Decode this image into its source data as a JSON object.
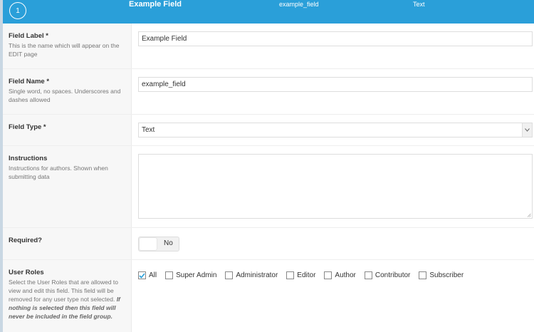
{
  "header": {
    "order": "1",
    "label": "Example Field",
    "name": "example_field",
    "type": "Text"
  },
  "field_label": {
    "title": "Field Label *",
    "desc": "This is the name which will appear on the EDIT page",
    "value": "Example Field"
  },
  "field_name": {
    "title": "Field Name *",
    "desc": "Single word, no spaces. Underscores and dashes allowed",
    "value": "example_field"
  },
  "field_type": {
    "title": "Field Type *",
    "selected": "Text"
  },
  "instructions": {
    "title": "Instructions",
    "desc": "Instructions for authors. Shown when submitting data",
    "value": ""
  },
  "required": {
    "title": "Required?",
    "toggle_label": "No"
  },
  "user_roles": {
    "title": "User Roles",
    "desc": "Select the User Roles that are allowed to view and edit this field. This field will be removed for any user type not selected.",
    "desc_emphasis": "If nothing is selected then this field will never be included in the field group.",
    "options": [
      {
        "label": "All",
        "checked": true
      },
      {
        "label": "Super Admin",
        "checked": false
      },
      {
        "label": "Administrator",
        "checked": false
      },
      {
        "label": "Editor",
        "checked": false
      },
      {
        "label": "Author",
        "checked": false
      },
      {
        "label": "Contributor",
        "checked": false
      },
      {
        "label": "Subscriber",
        "checked": false
      }
    ]
  },
  "colors": {
    "header_bg": "#2a9fd9",
    "label_col_bg": "#f7f7f7"
  },
  "icons": {
    "select_arrow": "chevron-down-icon",
    "check": "check-icon"
  }
}
